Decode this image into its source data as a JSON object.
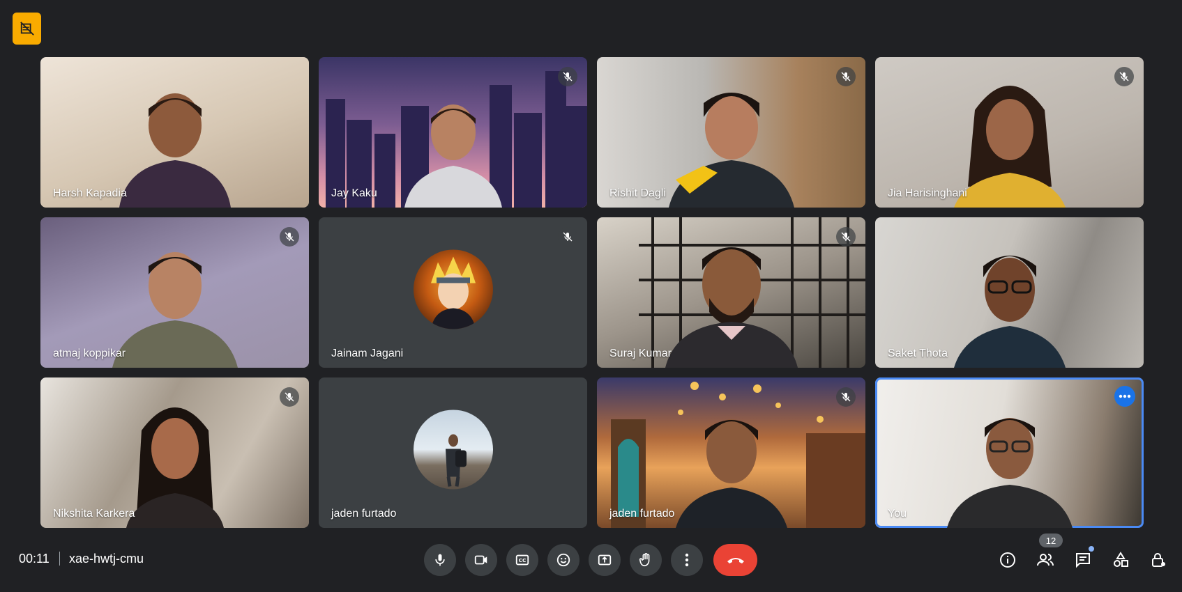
{
  "meeting": {
    "elapsed": "00:11",
    "code": "xae-hwtj-cmu",
    "participant_count": "12"
  },
  "colors": {
    "background": "#202124",
    "tile": "#3c4043",
    "end_call": "#ea4335",
    "accent": "#1a73e8",
    "badge": "#f9ab00"
  },
  "participants": [
    {
      "name": "Harsh Kapadia",
      "muted": false,
      "video": true
    },
    {
      "name": "Jay Kaku",
      "muted": true,
      "video": true
    },
    {
      "name": "Rishit Dagli",
      "muted": true,
      "video": true
    },
    {
      "name": "Jia Harisinghani",
      "muted": true,
      "video": true
    },
    {
      "name": "atmaj koppikar",
      "muted": true,
      "video": true
    },
    {
      "name": "Jainam Jagani",
      "muted": true,
      "video": false
    },
    {
      "name": "Suraj Kumar",
      "muted": true,
      "video": true
    },
    {
      "name": "Saket Thota",
      "muted": false,
      "video": true
    },
    {
      "name": "Nikshita Karkera",
      "muted": true,
      "video": true
    },
    {
      "name": "jaden furtado",
      "muted": false,
      "video": false
    },
    {
      "name": "jaden furtado",
      "muted": true,
      "video": true
    },
    {
      "name": "You",
      "muted": false,
      "video": true
    }
  ],
  "controls": [
    "microphone-icon",
    "camera-icon",
    "captions-icon",
    "emoji-icon",
    "present-icon",
    "raise-hand-icon",
    "more-options-icon",
    "end-call-icon"
  ],
  "right_icons": [
    "info-icon",
    "people-icon",
    "chat-icon",
    "activities-icon",
    "host-controls-icon"
  ]
}
